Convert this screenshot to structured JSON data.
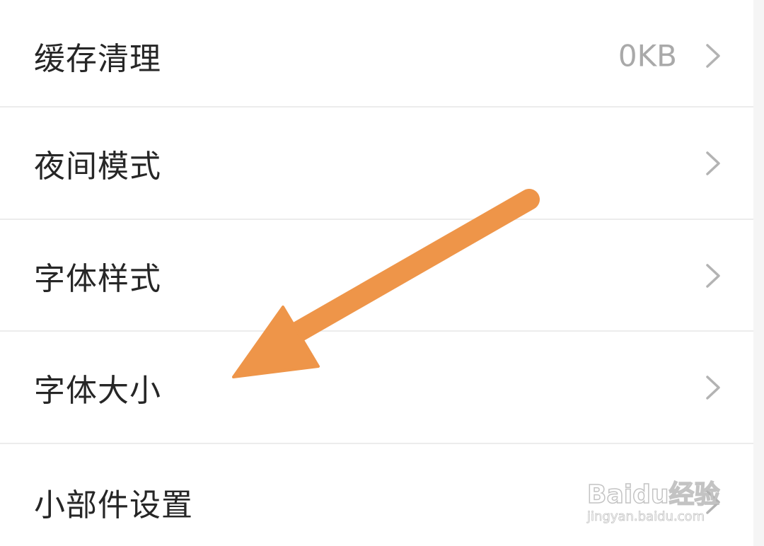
{
  "settings": {
    "items": [
      {
        "label": "缓存清理",
        "value": "0KB"
      },
      {
        "label": "夜间模式"
      },
      {
        "label": "字体样式"
      },
      {
        "label": "字体大小"
      },
      {
        "label": "小部件设置"
      }
    ]
  },
  "icons": {
    "row_chevron": "chevron-right-icon",
    "annotation": "arrow-annotation"
  },
  "colors": {
    "label_text": "#262626",
    "value_text": "#a9a9a9",
    "chevron": "#b3b3b3",
    "divider": "#ececec",
    "arrow": "#ee9549"
  },
  "watermark": {
    "logo": "Baidu经验",
    "url": "jingyan.baidu.com"
  }
}
